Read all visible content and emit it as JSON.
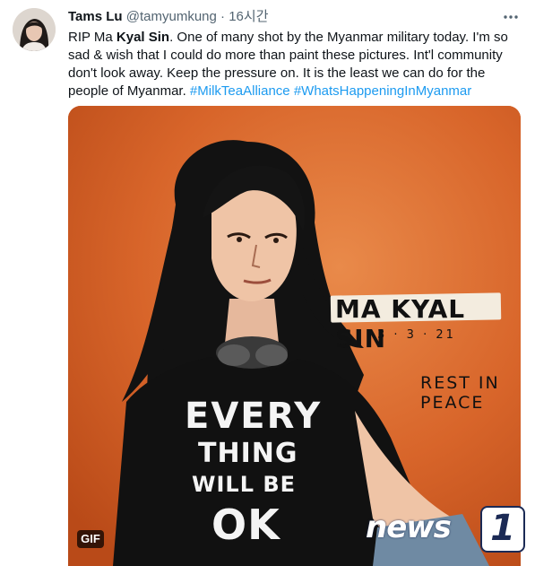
{
  "tweet": {
    "display_name": "Tams Lu",
    "handle": "@tamyumkung",
    "separator": "·",
    "time": "16시간",
    "body_parts": {
      "p1": "RIP Ma ",
      "p2_bold": "Kyal Sin",
      "p3": ". One of many shot by the Myanmar military today. I'm so sad & wish that I could do more than paint these pictures. Int'l community don't look away. Keep the pressure on. It is the least we can do for the people of Myanmar. ",
      "hashtag1": "#MilkTeaAlliance",
      "space": " ",
      "hashtag2": "#WhatsHappeningInMyanmar"
    },
    "more_icon": "more-dots-icon",
    "hashtag_color": "#1d9bf0"
  },
  "media": {
    "gif_badge": "GIF",
    "background_color": "#d9662a",
    "artwork_text": {
      "rest_in_peace": "REST IN PEACE",
      "name": "MA KYAL SIN",
      "date": "3 · 3 · 21",
      "shirt_line1": "EVERY",
      "shirt_line2": "THING",
      "shirt_line3": "WILL BE",
      "shirt_line4": "OK"
    }
  },
  "watermark": {
    "text": "news",
    "number": "1"
  }
}
